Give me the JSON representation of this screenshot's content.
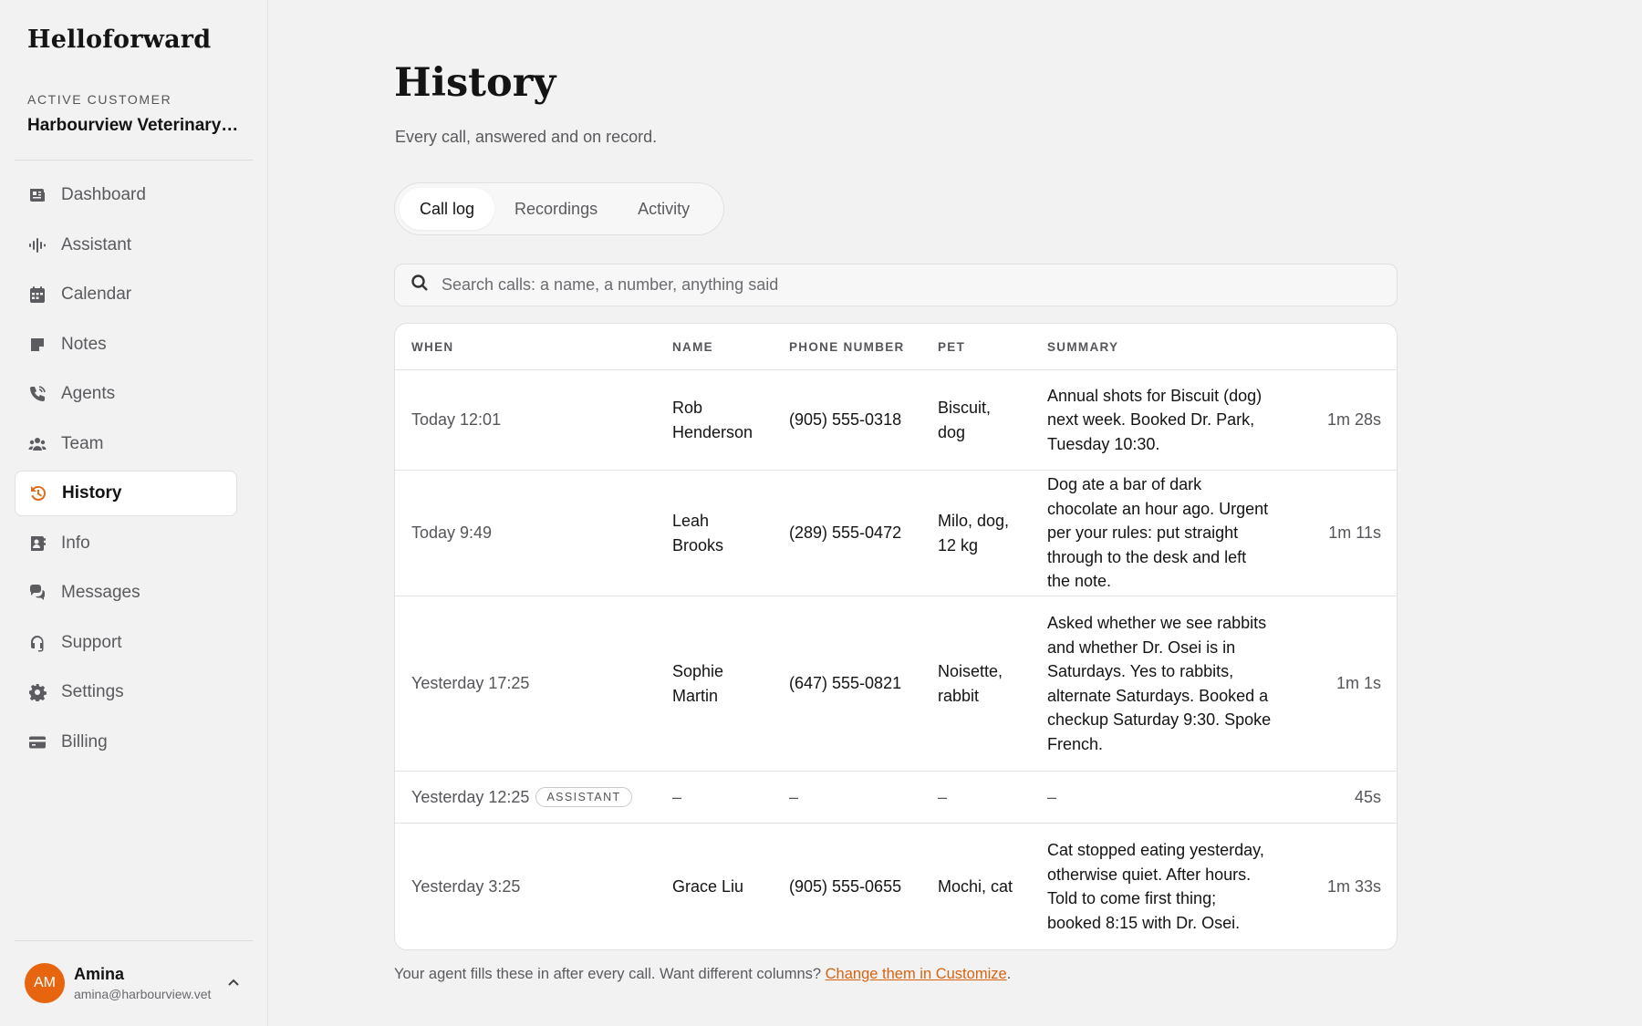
{
  "app": {
    "brand": "Helloforward"
  },
  "customer": {
    "label": "ACTIVE CUSTOMER",
    "name": "Harbourview Veterinary Clinic"
  },
  "nav": [
    {
      "label": "Dashboard",
      "icon": "dashboard-icon"
    },
    {
      "label": "Assistant",
      "icon": "waveform-icon"
    },
    {
      "label": "Calendar",
      "icon": "calendar-icon"
    },
    {
      "label": "Notes",
      "icon": "note-icon"
    },
    {
      "label": "Agents",
      "icon": "phone-icon"
    },
    {
      "label": "Team",
      "icon": "team-icon"
    },
    {
      "label": "History",
      "icon": "history-icon",
      "active": true
    },
    {
      "label": "Info",
      "icon": "contact-card-icon"
    },
    {
      "label": "Messages",
      "icon": "chat-icon"
    },
    {
      "label": "Support",
      "icon": "headset-icon"
    },
    {
      "label": "Settings",
      "icon": "gear-icon"
    },
    {
      "label": "Billing",
      "icon": "card-icon"
    }
  ],
  "user": {
    "initials": "AM",
    "name": "Amina",
    "email": "amina@harbourview.vet"
  },
  "page": {
    "title": "History",
    "subtitle": "Every call, answered and on record."
  },
  "tabs": [
    {
      "label": "Call log",
      "active": true
    },
    {
      "label": "Recordings"
    },
    {
      "label": "Activity"
    }
  ],
  "search": {
    "placeholder": "Search calls: a name, a number, anything said"
  },
  "table": {
    "headers": [
      "WHEN",
      "NAME",
      "PHONE NUMBER",
      "PET",
      "SUMMARY",
      ""
    ],
    "rows": [
      {
        "when": "Today 12:01",
        "badge": "",
        "name": "Rob Henderson",
        "phone": "(905) 555-0318",
        "pet": "Biscuit, dog",
        "summary": "Annual shots for Biscuit (dog) next week. Booked Dr. Park, Tuesday 10:30.",
        "duration": "1m 28s"
      },
      {
        "when": "Today 9:49",
        "badge": "",
        "name": "Leah Brooks",
        "phone": "(289) 555-0472",
        "pet": "Milo, dog, 12 kg",
        "summary": "Dog ate a bar of dark chocolate an hour ago. Urgent per your rules: put straight through to the desk and left the note.",
        "duration": "1m 11s"
      },
      {
        "when": "Yesterday 17:25",
        "badge": "",
        "name": "Sophie Martin",
        "phone": "(647) 555-0821",
        "pet": "Noisette, rabbit",
        "summary": "Asked whether we see rabbits and whether Dr. Osei is in Saturdays. Yes to rabbits, alternate Saturdays. Booked a checkup Saturday 9:30. Spoke French.",
        "duration": "1m 1s"
      },
      {
        "when": "Yesterday 12:25",
        "badge": "ASSISTANT",
        "name": "–",
        "phone": "–",
        "pet": "–",
        "summary": "–",
        "duration": "45s"
      },
      {
        "when": "Yesterday 3:25",
        "badge": "",
        "name": "Grace Liu",
        "phone": "(905) 555-0655",
        "pet": "Mochi, cat",
        "summary": "Cat stopped eating yesterday, otherwise quiet. After hours. Told to come first thing; booked 8:15 with Dr. Osei.",
        "duration": "1m 33s"
      }
    ]
  },
  "footnote": {
    "text": "Your agent fills these in after every call. Want different columns? ",
    "link": "Change them in Customize",
    "end": "."
  },
  "colors": {
    "accent": "#e06d1f",
    "avatar": "#e8650f",
    "link": "#d8630f"
  }
}
